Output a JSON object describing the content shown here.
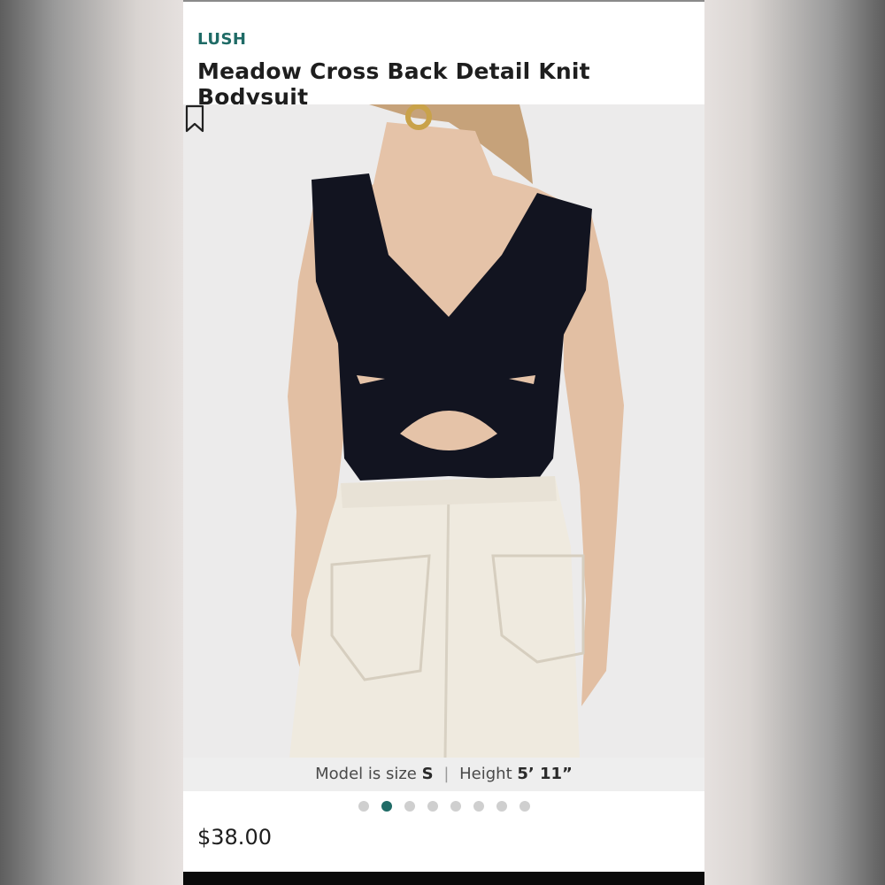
{
  "product": {
    "brand": "LUSH",
    "title": "Meadow Cross Back Detail Knit Bodysuit",
    "price": "$38.00"
  },
  "image": {
    "alt": "Model wearing black cross back bodysuit with white jeans, back view",
    "bookmark_icon": "bookmark-icon"
  },
  "model_info": {
    "size_label": "Model is size",
    "size_value": "S",
    "separator": "|",
    "height_label": "Height",
    "height_value": "5’ 11”"
  },
  "carousel": {
    "total": 8,
    "active_index": 1
  },
  "colors": {
    "brand": "#1f6b66",
    "dot_inactive": "#cfcfcf"
  }
}
